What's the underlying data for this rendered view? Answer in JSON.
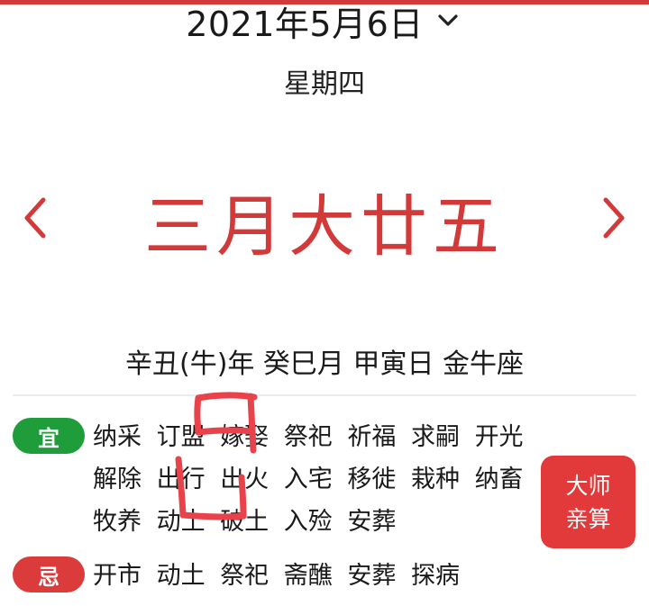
{
  "header": {
    "date": "2021年5月6日",
    "weekday": "星期四",
    "dropdown_icon": "chevron-down-icon"
  },
  "lunar": {
    "date": "三月大廿五",
    "prev_icon": "chevron-left-icon",
    "next_icon": "chevron-right-icon"
  },
  "ganzhi": {
    "text": "辛丑(牛)年 癸巳月 甲寅日 金牛座"
  },
  "yi": {
    "badge": "宜",
    "items": [
      "纳采",
      "订盟",
      "嫁娶",
      "祭祀",
      "祈福",
      "求嗣",
      "开光",
      "解除",
      "出行",
      "出火",
      "入宅",
      "移徙",
      "栽种",
      "纳畜",
      "牧养",
      "动土",
      "破土",
      "入殓",
      "安葬"
    ]
  },
  "ji": {
    "badge": "忌",
    "items": [
      "开市",
      "动土",
      "祭祀",
      "斋醮",
      "安葬",
      "探病"
    ]
  },
  "master_button": {
    "line1": "大师",
    "line2": "亲算"
  },
  "colors": {
    "accent": "#d23a3a",
    "yi_green": "#1f9d3a",
    "ji_red": "#dc3b3b",
    "button_red": "#e23a3a",
    "annotation": "#e8424a"
  }
}
